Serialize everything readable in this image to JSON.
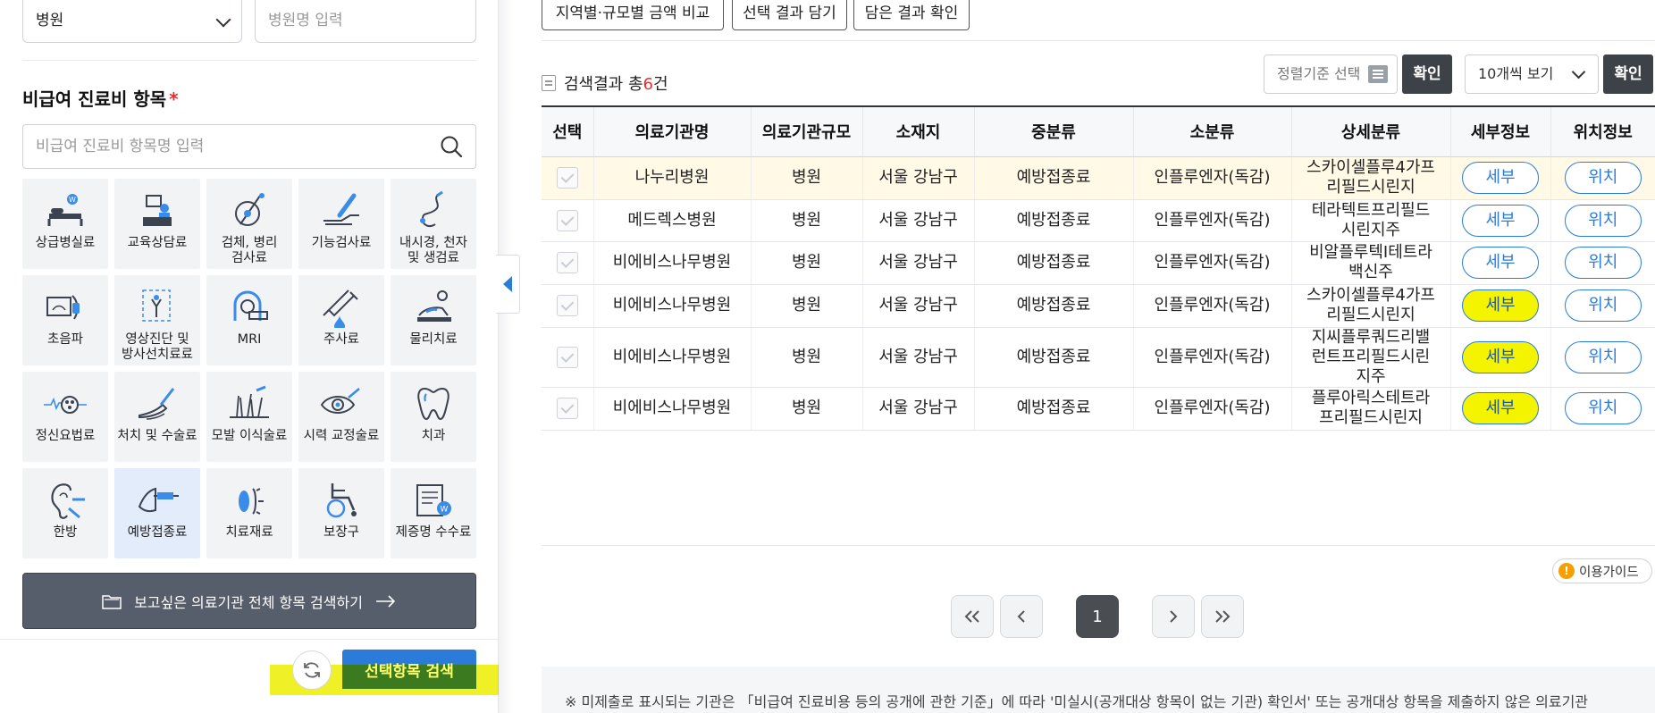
{
  "filters": {
    "hospital_type_selected": "병원",
    "hospital_name_placeholder": "병원명 입력"
  },
  "section": {
    "title": "비급여 진료비 항목",
    "required_mark": "*",
    "search_placeholder": "비급여 진료비 항목명 입력"
  },
  "categories": [
    {
      "label": "상급병실료",
      "icon": "hospital-bed-icon"
    },
    {
      "label": "교육상담료",
      "icon": "consultation-desk-icon"
    },
    {
      "label": "검체, 병리\n검사료",
      "icon": "specimen-test-icon"
    },
    {
      "label": "기능검사료",
      "icon": "function-test-icon"
    },
    {
      "label": "내시경, 천자\n및 생검료",
      "icon": "endoscope-icon"
    },
    {
      "label": "초음파",
      "icon": "ultrasound-icon"
    },
    {
      "label": "영상진단 및\n방사선치료료",
      "icon": "radiology-icon"
    },
    {
      "label": "MRI",
      "icon": "mri-icon"
    },
    {
      "label": "주사료",
      "icon": "syringe-icon"
    },
    {
      "label": "물리치료",
      "icon": "physical-therapy-icon"
    },
    {
      "label": "정신요법료",
      "icon": "brain-wave-icon"
    },
    {
      "label": "처치 및 수술료",
      "icon": "surgery-icon"
    },
    {
      "label": "모발 이식술료",
      "icon": "hair-transplant-icon"
    },
    {
      "label": "시력 교정술료",
      "icon": "eye-laser-icon"
    },
    {
      "label": "치과",
      "icon": "tooth-icon"
    },
    {
      "label": "한방",
      "icon": "acupuncture-ear-icon"
    },
    {
      "label": "예방접종료",
      "icon": "vaccination-icon",
      "active": true
    },
    {
      "label": "치료재료",
      "icon": "treatment-material-icon"
    },
    {
      "label": "보장구",
      "icon": "wheelchair-icon"
    },
    {
      "label": "제증명 수수료",
      "icon": "certificate-icon"
    }
  ],
  "all_items_button": "보고싶은 의료기관 전체 항목 검색하기",
  "search_selected_button": "선택항목 검색",
  "top_buttons": [
    "지역별·규모별 금액 비교",
    "선택 결과 담기",
    "담은 결과 확인"
  ],
  "results": {
    "prefix": "검색결과 총",
    "count": "6",
    "suffix": "건"
  },
  "sort": {
    "placeholder": "정렬기준 선택",
    "confirm": "확인",
    "per_page": "10개씩 보기",
    "confirm2": "확인"
  },
  "table": {
    "headers": [
      "선택",
      "의료기관명",
      "의료기관규모",
      "소재지",
      "중분류",
      "소분류",
      "상세분류",
      "세부정보",
      "위치정보"
    ],
    "detail_label": "세부",
    "location_label": "위치",
    "rows": [
      {
        "name": "나누리병원",
        "scale": "병원",
        "region": "서울 강남구",
        "mid": "예방접종료",
        "sub": "인플루엔자(독감)",
        "detail": "스카이셀플루4가프\n리필드시린지"
      },
      {
        "name": "메드렉스병원",
        "scale": "병원",
        "region": "서울 강남구",
        "mid": "예방접종료",
        "sub": "인플루엔자(독감)",
        "detail": "테라텍트프리필드\n시린지주"
      },
      {
        "name": "비에비스나무병원",
        "scale": "병원",
        "region": "서울 강남구",
        "mid": "예방접종료",
        "sub": "인플루엔자(독감)",
        "detail": "비알플루텍I테트라\n백신주"
      },
      {
        "name": "비에비스나무병원",
        "scale": "병원",
        "region": "서울 강남구",
        "mid": "예방접종료",
        "sub": "인플루엔자(독감)",
        "detail": "스카이셀플루4가프\n리필드시린지"
      },
      {
        "name": "비에비스나무병원",
        "scale": "병원",
        "region": "서울 강남구",
        "mid": "예방접종료",
        "sub": "인플루엔자(독감)",
        "detail": "지씨플루쿼드리밸\n런트프리필드시린\n지주"
      },
      {
        "name": "비에비스나무병원",
        "scale": "병원",
        "region": "서울 강남구",
        "mid": "예방접종료",
        "sub": "인플루엔자(독감)",
        "detail": "플루아릭스테트라\n프리필드시린지"
      }
    ]
  },
  "guide": "이용가이드",
  "pagination": {
    "current": "1"
  },
  "notice": "※ 미제출로 표시되는 기관은 「비급여 진료비용 등의 공개에 관한 기준」에 따라 '미실시(공개대상 항목이 없는 기관) 확인서' 또는 공개대상 항목을 제출하지 않은 의료기관"
}
